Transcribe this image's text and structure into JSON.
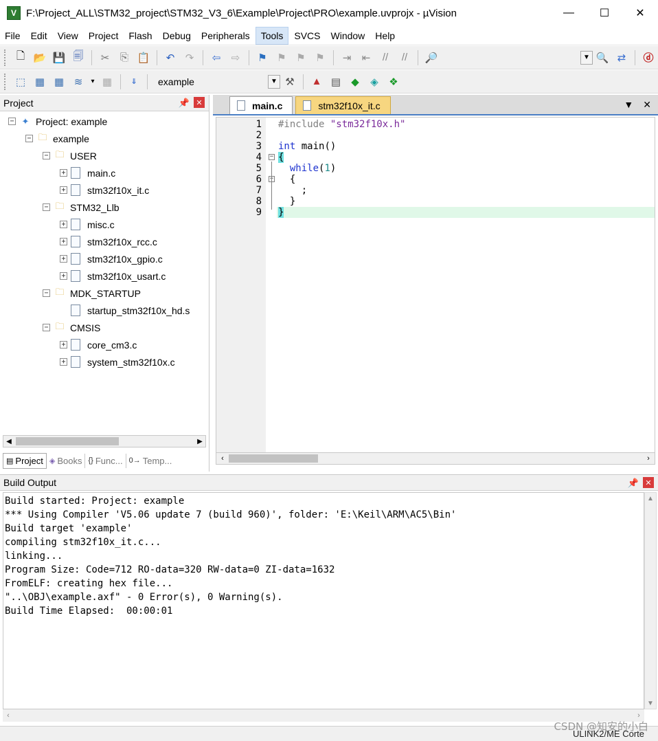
{
  "window": {
    "title": "F:\\Project_ALL\\STM32_project\\STM32_V3_6\\Example\\Project\\PRO\\example.uvprojx - µVision",
    "app_icon": "V",
    "min_glyph": "—",
    "max_glyph": "☐",
    "close_glyph": "✕"
  },
  "menu": [
    "File",
    "Edit",
    "View",
    "Project",
    "Flash",
    "Debug",
    "Peripherals",
    "Tools",
    "SVCS",
    "Window",
    "Help"
  ],
  "active_menu": "Tools",
  "toolbar": {
    "target_name": "example"
  },
  "project_panel": {
    "title": "Project",
    "tree": {
      "root": "Project: example",
      "target": "example",
      "groups": [
        {
          "name": "USER",
          "files": [
            "main.c",
            "stm32f10x_it.c"
          ]
        },
        {
          "name": "STM32_Llb",
          "files": [
            "misc.c",
            "stm32f10x_rcc.c",
            "stm32f10x_gpio.c",
            "stm32f10x_usart.c"
          ]
        },
        {
          "name": "MDK_STARTUP",
          "files": [
            "startup_stm32f10x_hd.s"
          ]
        },
        {
          "name": "CMSIS",
          "files": [
            "core_cm3.c",
            "system_stm32f10x.c"
          ]
        }
      ]
    },
    "tabs": [
      "Project",
      "Books",
      "Func...",
      "Temp..."
    ]
  },
  "editor": {
    "tabs": [
      "main.c",
      "stm32f10x_it.c"
    ],
    "active_tab": "main.c",
    "line_numbers": [
      "1",
      "2",
      "3",
      "4",
      "5",
      "6",
      "7",
      "8",
      "9"
    ],
    "code": {
      "l1_directive": "#include",
      "l1_string": "\"stm32f10x.h\"",
      "l3_kw": "int",
      "l3_rest": " main()",
      "l4": "{",
      "l5_kw": "while",
      "l5_open": "(",
      "l5_num": "1",
      "l5_close": ")",
      "l6": "  {",
      "l7": "    ;",
      "l8": "  }",
      "l9": "}"
    }
  },
  "build_output": {
    "title": "Build Output",
    "lines": [
      "Build started: Project: example",
      "*** Using Compiler 'V5.06 update 7 (build 960)', folder: 'E:\\Keil\\ARM\\AC5\\Bin'",
      "Build target 'example'",
      "compiling stm32f10x_it.c...",
      "linking...",
      "Program Size: Code=712 RO-data=320 RW-data=0 ZI-data=1632",
      "FromELF: creating hex file...",
      "\"..\\OBJ\\example.axf\" - 0 Error(s), 0 Warning(s).",
      "Build Time Elapsed:  00:00:01"
    ]
  },
  "status_bar": {
    "debugger": "ULINK2/ME Corte"
  },
  "watermark": "CSDN @知安的小白"
}
